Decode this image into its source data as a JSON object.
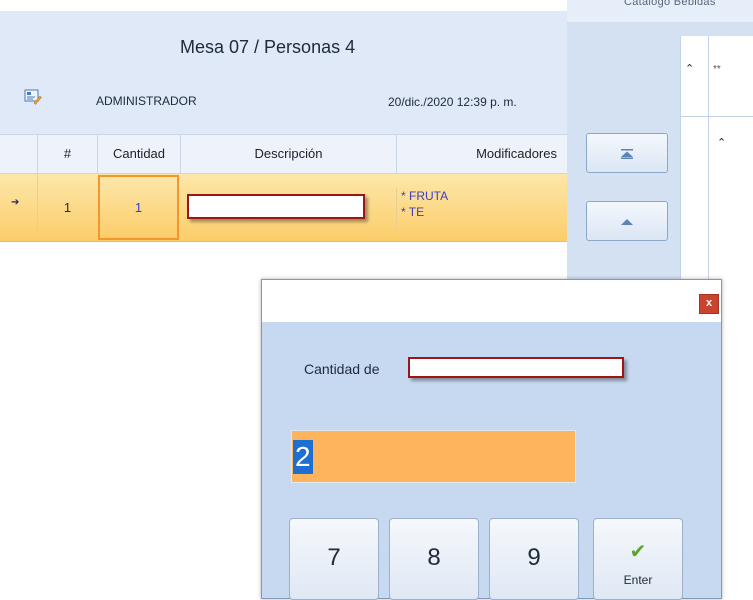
{
  "header": {
    "title": "Mesa 07 / Personas 4",
    "user": "ADMINISTRADOR",
    "datetime": "20/dic./2020 12:39 p. m.",
    "user_icon": "edit-user-icon"
  },
  "grid": {
    "columns": [
      "#",
      "Cantidad",
      "Descripción",
      "Modificadores"
    ],
    "rows": [
      {
        "number": "1",
        "quantity": "1",
        "description": "",
        "modifiers": [
          "* FRUTA",
          "* TE"
        ]
      }
    ],
    "row_indicator_icon": "current-row-arrow-icon"
  },
  "side_panel": {
    "tab_text": "Catálogo Bebidas",
    "nav_top_icon": "scroll-top-icon",
    "nav_up_icon": "scroll-up-icon",
    "catalog_star": "**"
  },
  "dialog": {
    "close_label": "x",
    "prompt_label": "Cantidad de",
    "item_name": "",
    "quantity_value": "2",
    "keys": [
      "7",
      "8",
      "9"
    ],
    "enter_label": "Enter",
    "enter_icon": "checkmark-icon"
  },
  "colors": {
    "header_bg": "#dfe9f7",
    "selected_row": "#fbcd6a",
    "quantity_border": "#f3962e",
    "input_bg": "#fdb45c",
    "dialog_bg": "#c7d9f1",
    "close_red": "#c9432f",
    "redaction_border": "#9e1515",
    "modifier_text": "#3b3dc9"
  }
}
